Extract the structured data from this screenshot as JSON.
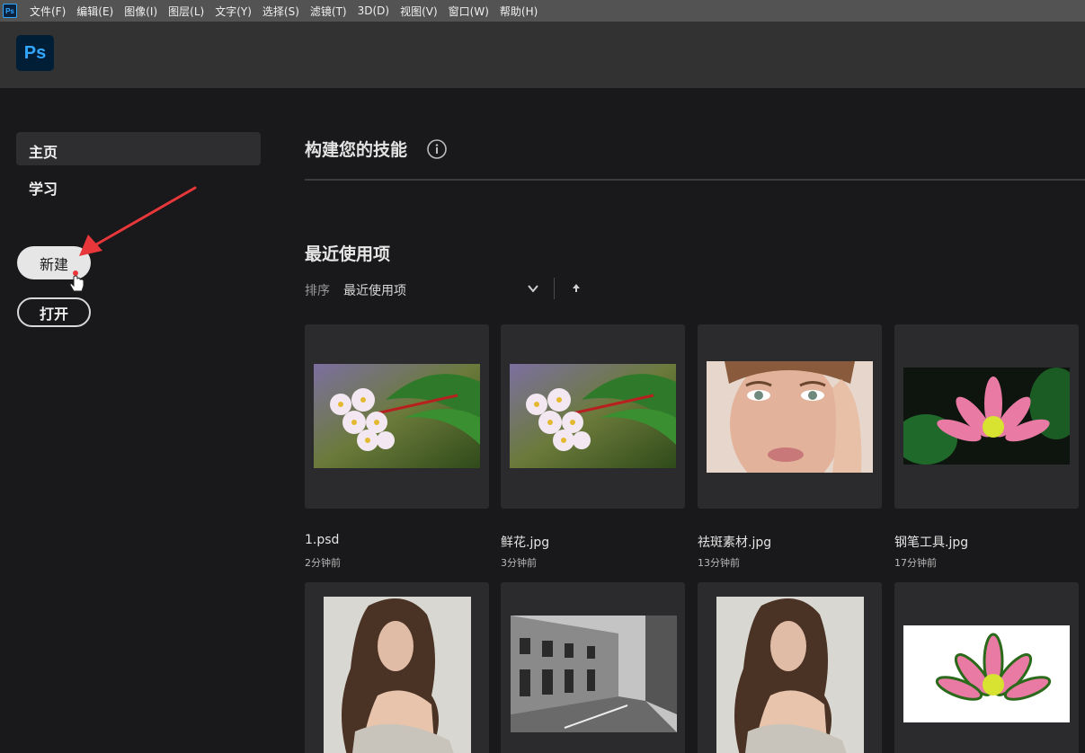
{
  "menubar": {
    "app_icon": "Ps",
    "items": [
      "文件(F)",
      "编辑(E)",
      "图像(I)",
      "图层(L)",
      "文字(Y)",
      "选择(S)",
      "滤镜(T)",
      "3D(D)",
      "视图(V)",
      "窗口(W)",
      "帮助(H)"
    ]
  },
  "header": {
    "logo_text": "Ps"
  },
  "sidebar": {
    "home": "主页",
    "learn": "学习",
    "new_button": "新建",
    "open_button": "打开"
  },
  "main": {
    "skills_title": "构建您的技能",
    "recent_title": "最近使用项",
    "sort_label": "排序",
    "sort_value": "最近使用项"
  },
  "recent_files": [
    {
      "name": "1.psd",
      "time": "2分钟前",
      "thumb": "plumeria-flowers"
    },
    {
      "name": "鲜花.jpg",
      "time": "3分钟前",
      "thumb": "plumeria-flowers"
    },
    {
      "name": "祛斑素材.jpg",
      "time": "13分钟前",
      "thumb": "woman-face-portrait"
    },
    {
      "name": "钢笔工具.jpg",
      "time": "17分钟前",
      "thumb": "pink-lotus-dark"
    },
    {
      "name": "",
      "time": "",
      "thumb": "woman-curly-hair"
    },
    {
      "name": "",
      "time": "",
      "thumb": "street-buildings-bw"
    },
    {
      "name": "",
      "time": "",
      "thumb": "woman-curly-hair"
    },
    {
      "name": "",
      "time": "",
      "thumb": "pink-lotus-white"
    }
  ],
  "colors": {
    "ps_blue": "#31a8ff",
    "ps_dark": "#001e36",
    "annotation_arrow": "#e8373a"
  }
}
